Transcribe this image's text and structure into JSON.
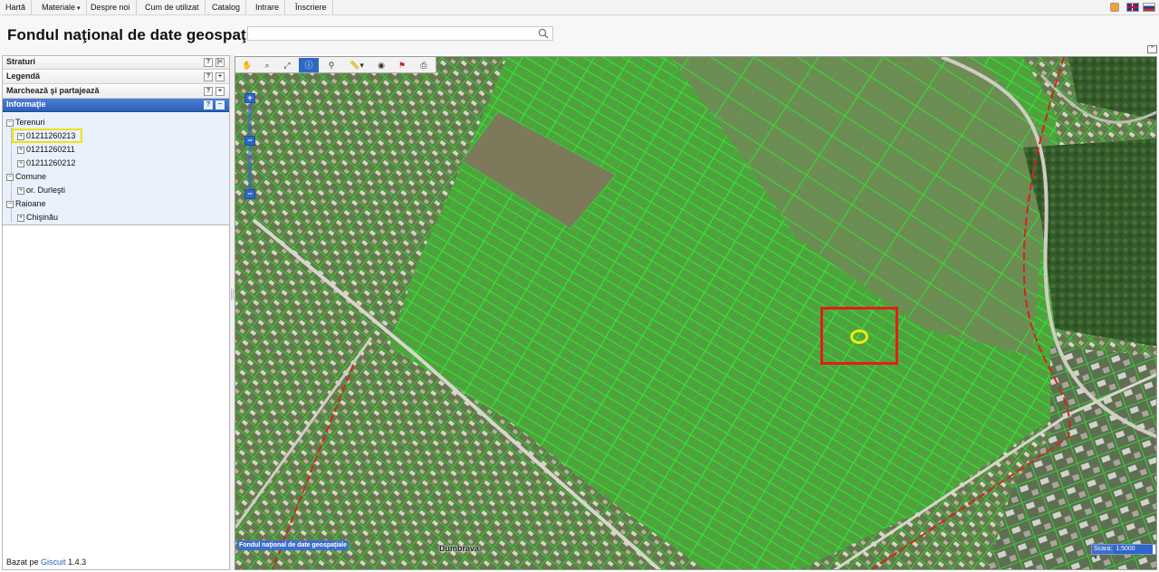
{
  "nav": {
    "items": [
      "Hartă",
      "Materiale",
      "Despre noi",
      "Cum de utilizat",
      "Catalog",
      "Intrare",
      "Înscriere"
    ],
    "dropdown_caret": "▾"
  },
  "header": {
    "title": "Fondul naţional de date geospaţiale",
    "search_placeholder": "",
    "collapse_icon": "⌃"
  },
  "panels": {
    "layers": "Straturi",
    "legend": "Legendă",
    "share": "Marchează şi partajează",
    "info": "Informaţie",
    "help_glyph": "?",
    "collapse_glyph": "|<",
    "expand_glyph": "+",
    "minimize_glyph": "−"
  },
  "tree": {
    "toggle_open": "−",
    "toggle_closed": "+",
    "groups": [
      {
        "label": "Terenuri",
        "items": [
          "01211260213",
          "01211260211",
          "01211260212"
        ]
      },
      {
        "label": "Comune",
        "items": [
          "or. Durleşti"
        ]
      },
      {
        "label": "Raioane",
        "items": [
          "Chişinău"
        ]
      }
    ]
  },
  "footer": {
    "prefix": "Bazat pe",
    "link": "Giscuit",
    "version": "1.4.3"
  },
  "map": {
    "caption": "Fondul naţional de date geospaţiale",
    "village": "Dumbrava",
    "scale_label": "Scara:",
    "scale_value": "1:5000",
    "zoom_in": "+",
    "zoom_out": "−",
    "tool_icons": [
      "pan-icon",
      "zoom-box-icon",
      "full-extent-icon",
      "info-icon",
      "binoculars-icon",
      "measure-icon",
      "target-icon",
      "flag-icon",
      "print-icon"
    ]
  },
  "colors": {
    "parcel_line": "#2fd42f",
    "highlight_red": "#e81a1a",
    "highlight_yellow": "#f2ea14",
    "accent_blue": "#2f66c8"
  }
}
